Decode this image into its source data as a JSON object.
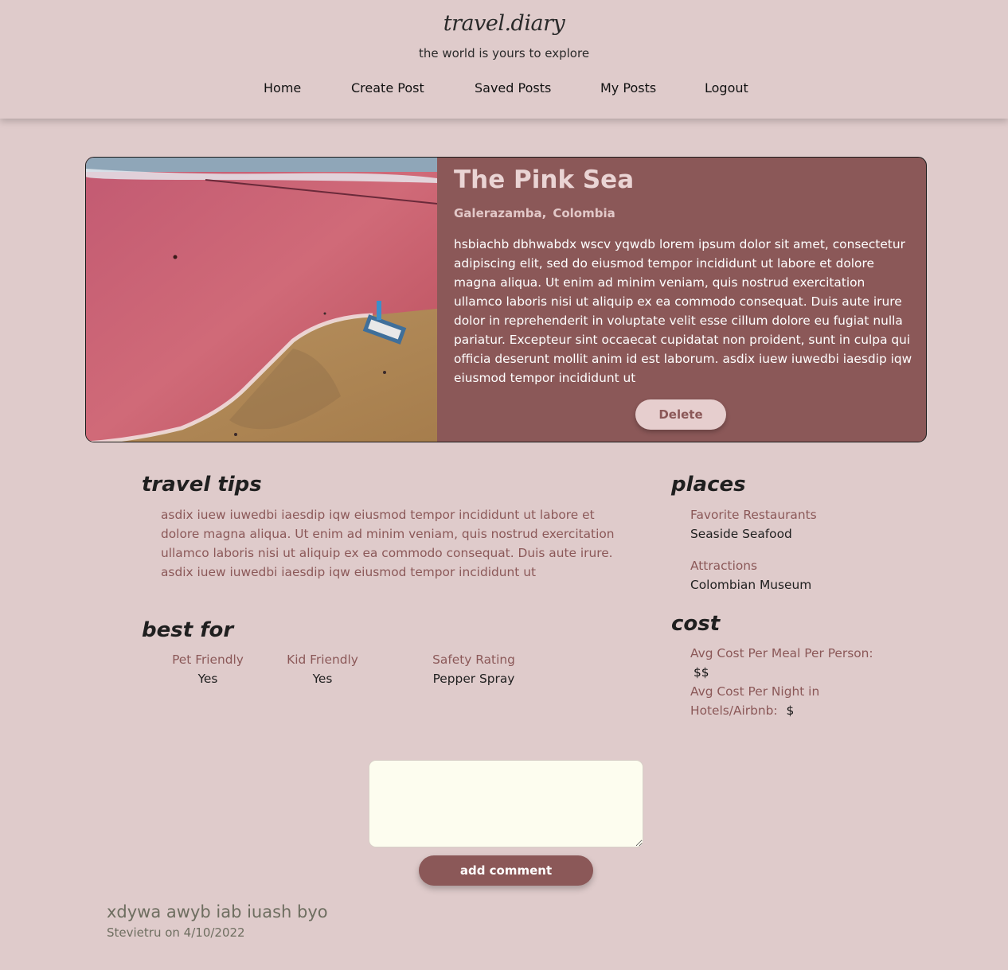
{
  "header": {
    "logo": "travel.diary",
    "tagline": "the world is yours to explore",
    "nav": [
      {
        "label": "Home"
      },
      {
        "label": "Create Post"
      },
      {
        "label": "Saved Posts"
      },
      {
        "label": "My Posts"
      },
      {
        "label": "Logout"
      }
    ]
  },
  "post": {
    "title": "The Pink Sea",
    "city": "Galerazamba,",
    "country": "Colombia",
    "body": "hsbiachb dbhwabdx wscv yqwdb lorem ipsum dolor sit amet, consectetur adipiscing elit, sed do eiusmod tempor incididunt ut labore et dolore magna aliqua. Ut enim ad minim veniam, quis nostrud exercitation ullamco laboris nisi ut aliquip ex ea commodo consequat. Duis aute irure dolor in reprehenderit in voluptate velit esse cillum dolore eu fugiat nulla pariatur. Excepteur sint occaecat cupidatat non proident, sunt in culpa qui officia deserunt mollit anim id est laborum. asdix iuew iuwedbi iaesdip iqw eiusmod tempor incididunt ut",
    "delete_label": "Delete"
  },
  "travel_tips": {
    "heading": "travel tips",
    "text": "asdix iuew iuwedbi iaesdip iqw eiusmod tempor incididunt ut labore et dolore magna aliqua. Ut enim ad minim veniam, quis nostrud exercitation ullamco laboris nisi ut aliquip ex ea commodo consequat. Duis aute irure. asdix iuew iuwedbi iaesdip iqw eiusmod tempor incididunt ut"
  },
  "best_for": {
    "heading": "best for",
    "items": [
      {
        "label": "Pet Friendly",
        "value": "Yes"
      },
      {
        "label": "Kid Friendly",
        "value": "Yes"
      },
      {
        "label": "Safety Rating",
        "value": "Pepper Spray"
      }
    ]
  },
  "places": {
    "heading": "places",
    "items": [
      {
        "label": "Favorite Restaurants",
        "value": "Seaside Seafood"
      },
      {
        "label": "Attractions",
        "value": "Colombian Museum"
      }
    ]
  },
  "cost": {
    "heading": "cost",
    "meal_label": "Avg Cost Per Meal Per Person:",
    "meal_value": "$$",
    "hotel_label": "Avg Cost Per Night in Hotels/Airbnb:",
    "hotel_value": "$"
  },
  "comments": {
    "input_value": "",
    "add_label": "add comment",
    "items": [
      {
        "text": "xdywa awyb iab iuash byo",
        "meta": "Stevietru on 4/10/2022"
      }
    ]
  },
  "colors": {
    "background": "#dfcbcb",
    "accent": "#8b5858",
    "comment_bg": "#fdfdef"
  }
}
